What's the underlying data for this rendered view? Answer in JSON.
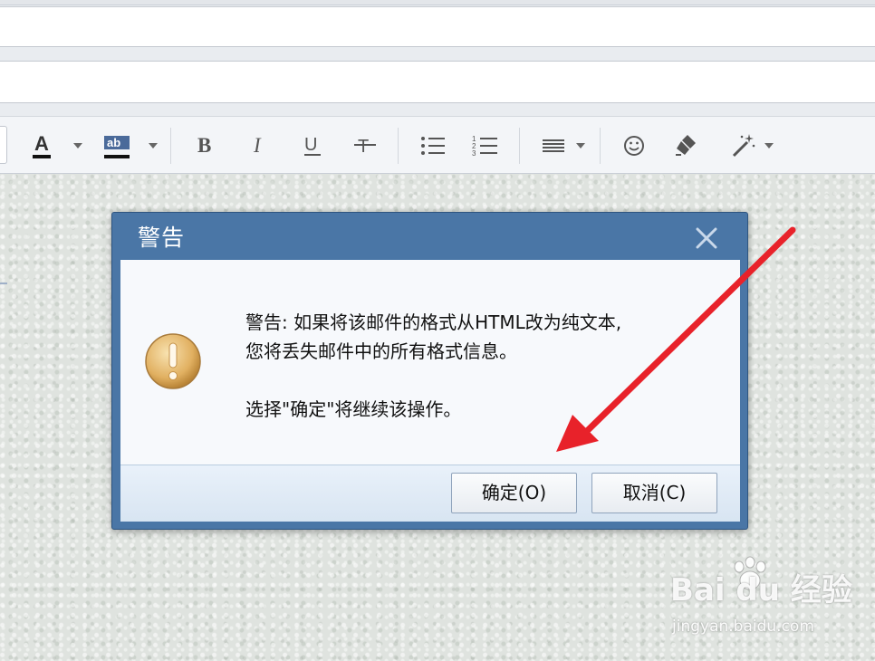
{
  "dialog": {
    "title": "警告",
    "message_line1": "警告: 如果将该邮件的格式从HTML改为纯文本,",
    "message_line2": "您将丢失邮件中的所有格式信息。",
    "message_line3": "选择\"确定\"将继续该操作。",
    "ok_label": "确定(O)",
    "cancel_label": "取消(C)"
  },
  "toolbar": {
    "items": [
      "font-color-icon",
      "highlight-color-icon",
      "bold-icon",
      "italic-icon",
      "underline-icon",
      "strikethrough-icon",
      "bullet-list-icon",
      "numbered-list-icon",
      "align-icon",
      "emoji-icon",
      "clear-format-icon",
      "magic-wand-icon"
    ]
  },
  "watermark": {
    "brand": "Bai du 经验",
    "url": "jingyan.baidu.com"
  },
  "colors": {
    "dialog_frame": "#4a76a6",
    "annotation_arrow": "#e8222a",
    "warning_icon": "#e1b061"
  }
}
